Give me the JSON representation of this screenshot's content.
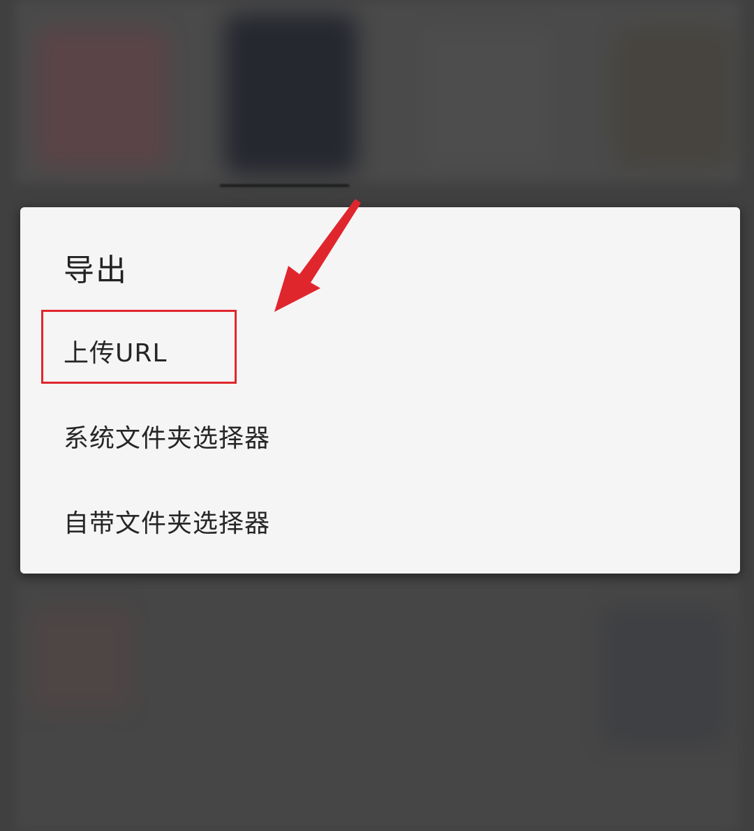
{
  "dialog": {
    "title": "导出",
    "options": [
      {
        "label": "上传URL",
        "highlighted": true
      },
      {
        "label": "系统文件夹选择器",
        "highlighted": false
      },
      {
        "label": "自带文件夹选择器",
        "highlighted": false
      }
    ]
  },
  "annotation": {
    "highlight_color": "#e0262d",
    "arrow_color": "#e0262d"
  },
  "colors": {
    "dialog_background": "#f5f5f5",
    "overlay_background": "#404040",
    "text": "#262626"
  }
}
